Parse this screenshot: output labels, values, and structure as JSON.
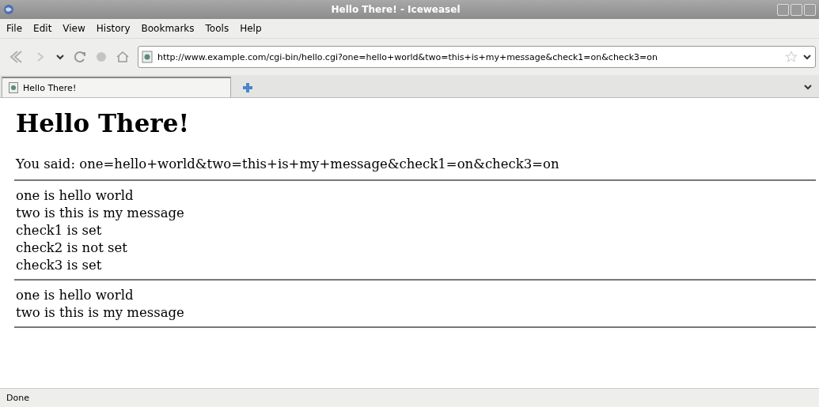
{
  "window": {
    "title": "Hello There! - Iceweasel"
  },
  "menu": [
    "File",
    "Edit",
    "View",
    "History",
    "Bookmarks",
    "Tools",
    "Help"
  ],
  "address": {
    "value": "http://www.example.com/cgi-bin/hello.cgi?one=hello+world&two=this+is+my+message&check1=on&check3=on"
  },
  "tabs": [
    {
      "label": "Hello There!",
      "selected": true
    }
  ],
  "page": {
    "heading": "Hello There!",
    "you_said": "You said: one=hello+world&two=this+is+my+message&check1=on&check3=on",
    "sections": [
      [
        "one is hello world",
        "two is this is my message",
        "check1 is set",
        "check2 is not set",
        "check3 is set"
      ],
      [
        "one is hello world",
        "two is this is my message"
      ]
    ]
  },
  "status_bar": "Done"
}
